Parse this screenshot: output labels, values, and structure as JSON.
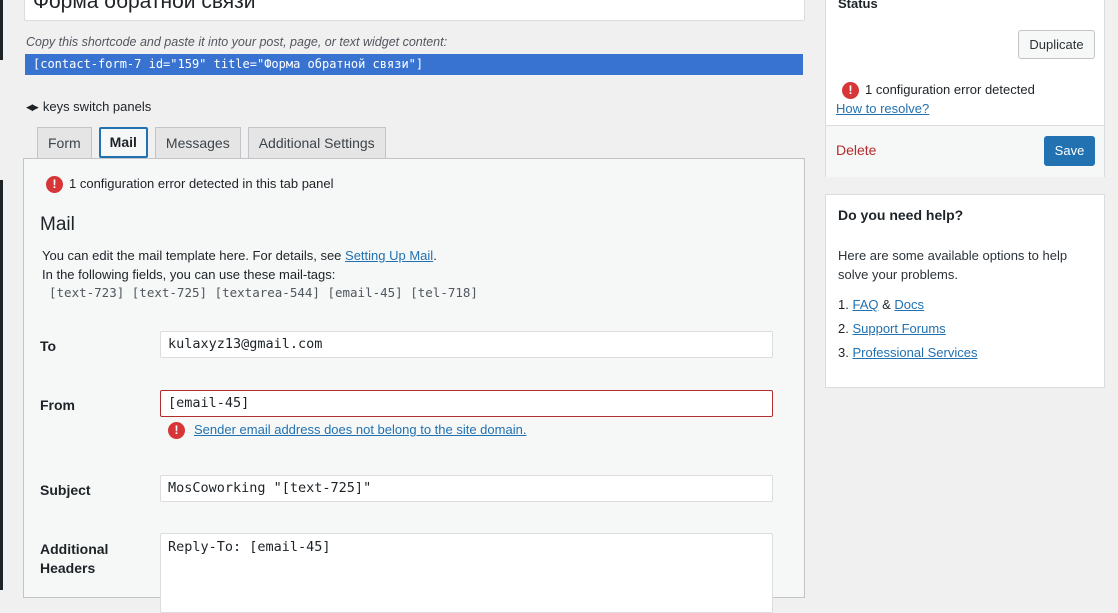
{
  "form": {
    "title_value": "Форма обратной связи",
    "shortcode_desc": "Copy this shortcode and paste it into your post, page, or text widget content:",
    "shortcode": "[contact-form-7 id=\"159\" title=\"Форма обратной связи\"]",
    "keys_hint": "keys switch panels"
  },
  "tabs": [
    {
      "label": "Form"
    },
    {
      "label": "Mail"
    },
    {
      "label": "Messages"
    },
    {
      "label": "Additional Settings"
    }
  ],
  "panel": {
    "error_text": "1 configuration error detected in this tab panel",
    "heading": "Mail",
    "desc_prefix": "You can edit the mail template here. For details, see ",
    "desc_link": "Setting Up Mail",
    "desc_suffix": ".",
    "desc_line2": "In the following fields, you can use these mail-tags:",
    "mail_tags": "[text-723] [text-725] [textarea-544] [email-45] [tel-718]",
    "fields": {
      "to": {
        "label": "To",
        "value": "kulaxyz13@gmail.com"
      },
      "from": {
        "label": "From",
        "value": "[email-45]",
        "error": "Sender email address does not belong to the site domain."
      },
      "subject": {
        "label": "Subject",
        "value": "MosCoworking \"[text-725]\""
      },
      "additional_headers": {
        "label_line1": "Additional",
        "label_line2": "Headers",
        "value": "Reply-To: [email-45]"
      }
    }
  },
  "status": {
    "title": "Status",
    "duplicate": "Duplicate",
    "error_text": "1 configuration error detected",
    "resolve_link": "How to resolve?",
    "delete": "Delete",
    "save": "Save"
  },
  "help": {
    "title": "Do you need help?",
    "text": "Here are some available options to help solve your problems.",
    "items": [
      {
        "num": "1.",
        "link1": "FAQ",
        "sep": "&",
        "link2": "Docs"
      },
      {
        "num": "2.",
        "link1": "Support Forums"
      },
      {
        "num": "3.",
        "link1": "Professional Services"
      }
    ]
  },
  "colors": {
    "accent": "#2271b1",
    "shortcode_bg": "#3873d1",
    "error": "#d63638",
    "delete": "#b32d2e"
  }
}
